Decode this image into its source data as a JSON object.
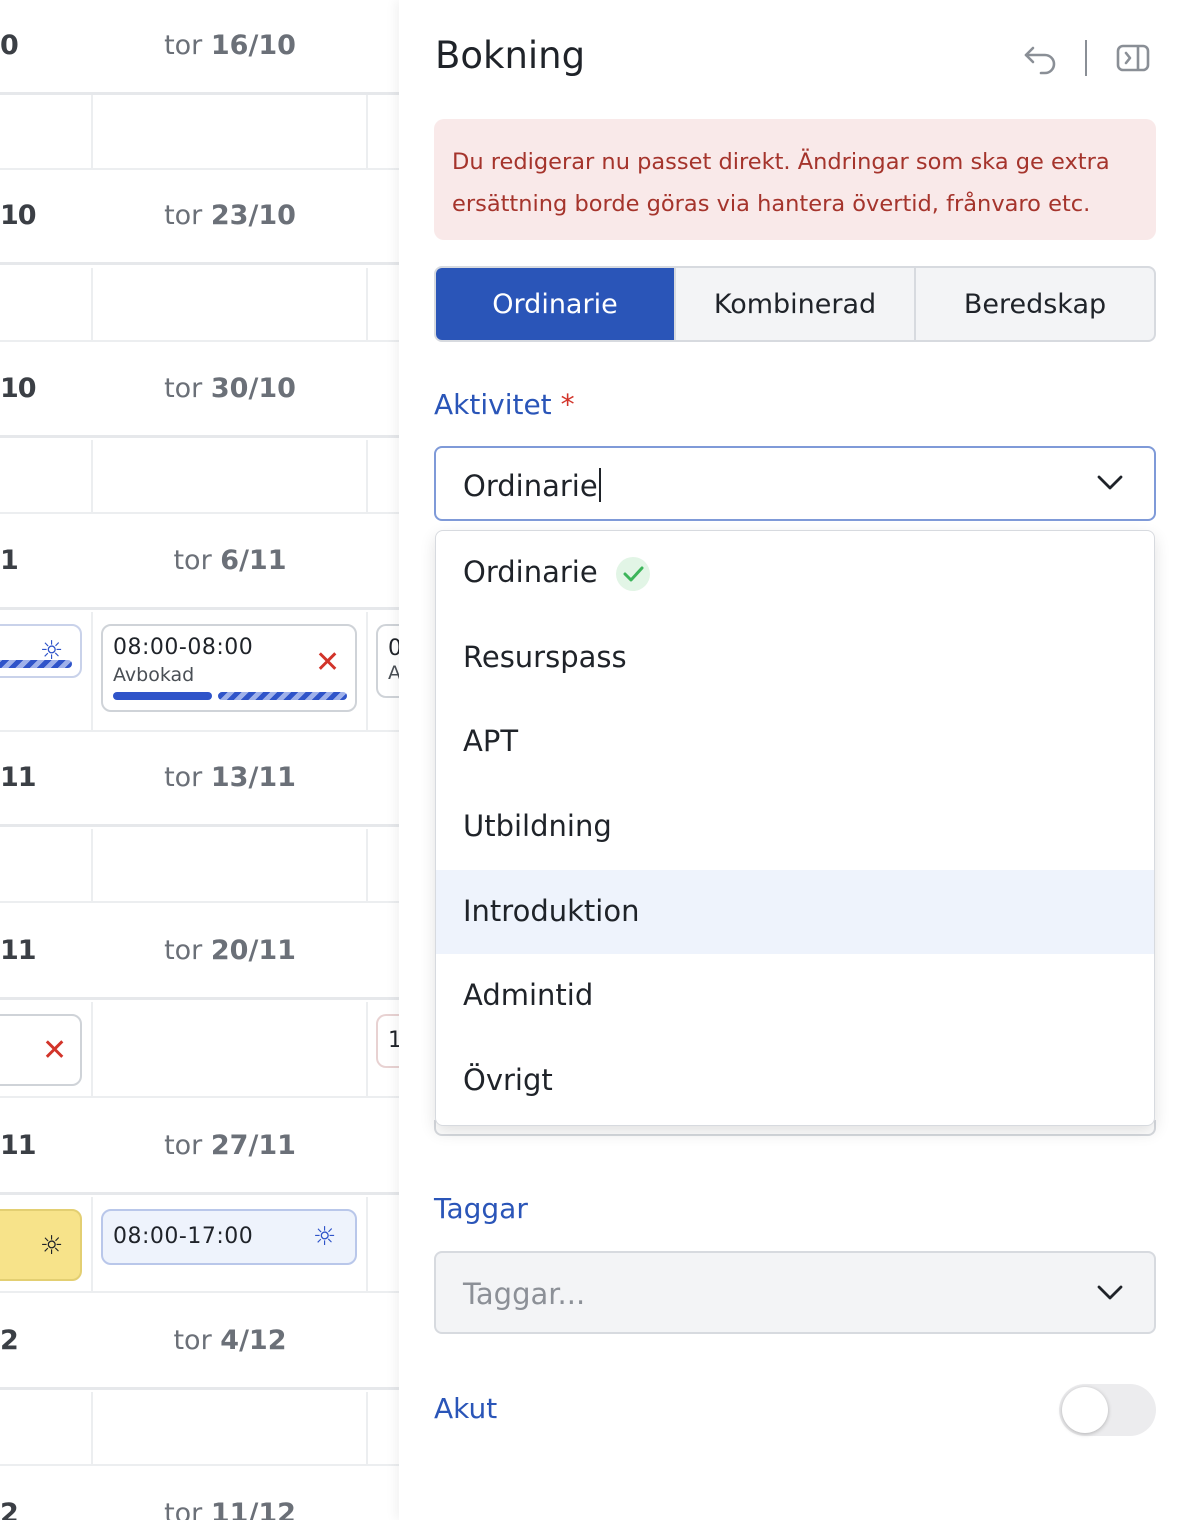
{
  "calendar": {
    "weeks": [
      {
        "prev": "0",
        "day": "tor",
        "date": "16/10"
      },
      {
        "prev": "10",
        "day": "tor",
        "date": "23/10"
      },
      {
        "prev": "10",
        "day": "tor",
        "date": "30/10"
      },
      {
        "prev": "1",
        "day": "tor",
        "date": "6/11"
      },
      {
        "prev": "11",
        "day": "tor",
        "date": "13/11"
      },
      {
        "prev": "11",
        "day": "tor",
        "date": "20/11"
      },
      {
        "prev": "11",
        "day": "tor",
        "date": "27/11"
      },
      {
        "prev": "2",
        "day": "tor",
        "date": "4/12"
      },
      {
        "prev": "2",
        "day": "tor",
        "date": "11/12"
      }
    ],
    "shift_6_11": {
      "time": "08:00-08:00",
      "status": "Avbokad",
      "partial": "0",
      "partial_sub": "A"
    },
    "shift_20_11": {
      "partial": "1"
    },
    "shift_27_11": {
      "time": "08:00-17:00"
    }
  },
  "panel": {
    "title": "Bokning",
    "warning": "Du redigerar nu passet direkt. Ändringar som ska ge extra ersättning borde göras via hantera övertid, frånvaro etc.",
    "tabs": [
      "Ordinarie",
      "Kombinerad",
      "Beredskap"
    ],
    "activity": {
      "label": "Aktivitet",
      "required_mark": "*",
      "value": "Ordinarie",
      "options": [
        "Ordinarie",
        "Resurspass",
        "APT",
        "Utbildning",
        "Introduktion",
        "Admintid",
        "Övrigt"
      ],
      "selected_option": "Ordinarie",
      "highlighted_option": "Introduktion"
    },
    "tags": {
      "label": "Taggar",
      "placeholder": "Taggar..."
    },
    "urgent": {
      "label": "Akut",
      "on": false
    }
  },
  "colors": {
    "accent": "#2a55b8",
    "warning_bg": "#f9e9e9",
    "warning_text": "#a5342c",
    "cancel_red": "#d2342a",
    "check_green": "#3cb55a",
    "sun_yellow_bg": "#f7e38a"
  }
}
